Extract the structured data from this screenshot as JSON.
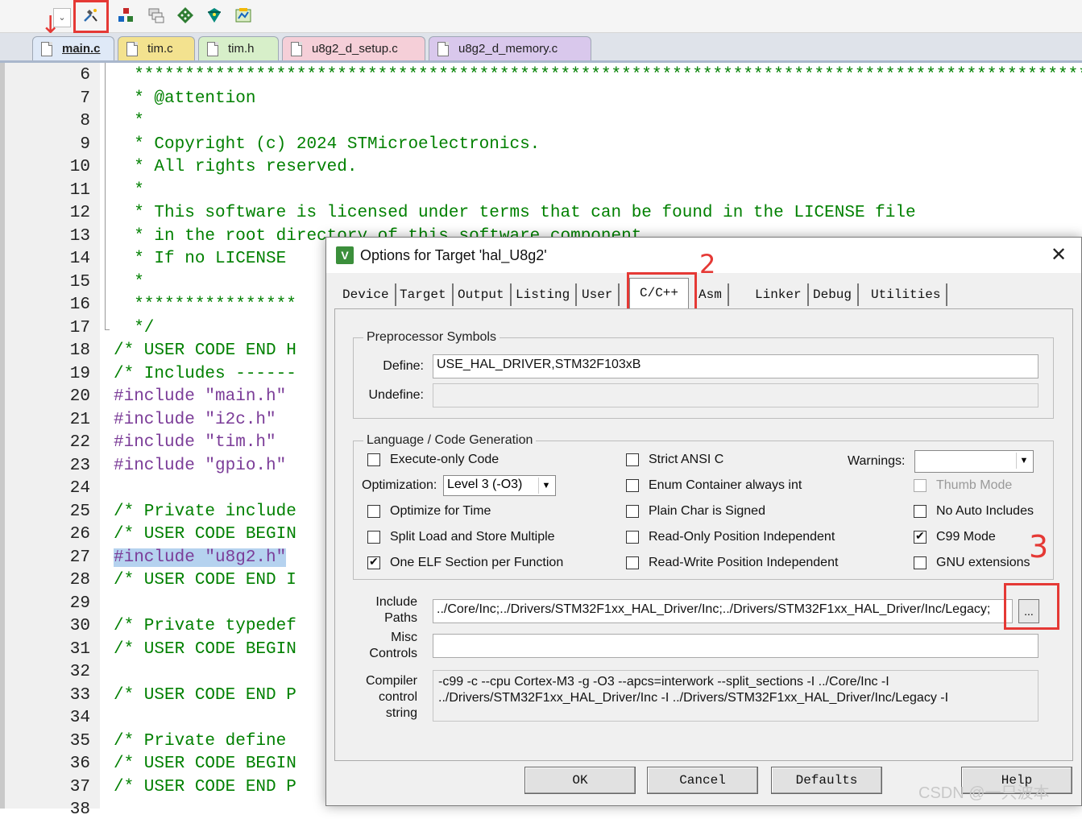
{
  "toolbar": {
    "dropdown_arrow": "⌄",
    "buttons": [
      {
        "name": "options-for-target-icon",
        "color": "#2b6cb0"
      },
      {
        "name": "manage-project-items-icon",
        "color": "#c62828"
      },
      {
        "name": "select-packs-icon",
        "color": "#777777"
      },
      {
        "name": "manage-run-time-environment-icon",
        "color": "#2e7d32"
      },
      {
        "name": "pack-installer-icon",
        "color": "#00897b"
      },
      {
        "name": "configure-icon",
        "color": "#558b2f"
      }
    ]
  },
  "tabs": [
    {
      "label": "main.c",
      "active": true,
      "color": "#dfe9f7"
    },
    {
      "label": "tim.c",
      "color": "#f3e28f"
    },
    {
      "label": "tim.h",
      "color": "#d7efc9"
    },
    {
      "label": "u8g2_d_setup.c",
      "color": "#f5cfd8"
    },
    {
      "label": "u8g2_d_memory.c",
      "color": "#d9c8ec"
    }
  ],
  "editor": {
    "lines": [
      {
        "n": "6",
        "text": "  **************************************************************************************************",
        "kind": "comment"
      },
      {
        "n": "7",
        "text": "  * @attention",
        "kind": "comment"
      },
      {
        "n": "8",
        "text": "  *",
        "kind": "comment"
      },
      {
        "n": "9",
        "text": "  * Copyright (c) 2024 STMicroelectronics.",
        "kind": "comment"
      },
      {
        "n": "10",
        "text": "  * All rights reserved.",
        "kind": "comment"
      },
      {
        "n": "11",
        "text": "  *",
        "kind": "comment"
      },
      {
        "n": "12",
        "text": "  * This software is licensed under terms that can be found in the LICENSE file",
        "kind": "comment"
      },
      {
        "n": "13",
        "text": "  * in the root directory of this software component.",
        "kind": "comment"
      },
      {
        "n": "14",
        "text": "  * If no LICENSE",
        "kind": "comment"
      },
      {
        "n": "15",
        "text": "  *",
        "kind": "comment"
      },
      {
        "n": "16",
        "text": "  ****************",
        "kind": "comment"
      },
      {
        "n": "17",
        "text": "  */",
        "kind": "comment"
      },
      {
        "n": "18",
        "text": "/* USER CODE END H",
        "kind": "comment"
      },
      {
        "n": "19",
        "text": "/* Includes ------",
        "kind": "comment"
      },
      {
        "n": "20",
        "pre": "#include ",
        "str": "\"main.h\"",
        "kind": "include"
      },
      {
        "n": "21",
        "pre": "#include ",
        "str": "\"i2c.h\"",
        "kind": "include"
      },
      {
        "n": "22",
        "pre": "#include ",
        "str": "\"tim.h\"",
        "kind": "include"
      },
      {
        "n": "23",
        "pre": "#include ",
        "str": "\"gpio.h\"",
        "kind": "include"
      },
      {
        "n": "24",
        "text": "",
        "kind": "comment"
      },
      {
        "n": "25",
        "text": "/* Private include",
        "kind": "comment"
      },
      {
        "n": "26",
        "text": "/* USER CODE BEGIN",
        "kind": "comment"
      },
      {
        "n": "27",
        "pre": "#include ",
        "str": "\"u8g2.h\"",
        "kind": "include",
        "selected": true
      },
      {
        "n": "28",
        "text": "/* USER CODE END I",
        "kind": "comment"
      },
      {
        "n": "29",
        "text": "",
        "kind": "comment"
      },
      {
        "n": "30",
        "text": "/* Private typedef",
        "kind": "comment"
      },
      {
        "n": "31",
        "text": "/* USER CODE BEGIN",
        "kind": "comment"
      },
      {
        "n": "32",
        "text": "",
        "kind": "comment"
      },
      {
        "n": "33",
        "text": "/* USER CODE END P",
        "kind": "comment"
      },
      {
        "n": "34",
        "text": "",
        "kind": "comment"
      },
      {
        "n": "35",
        "text": "/* Private define ",
        "kind": "comment"
      },
      {
        "n": "36",
        "text": "/* USER CODE BEGIN",
        "kind": "comment"
      },
      {
        "n": "37",
        "text": "/* USER CODE END P",
        "kind": "comment"
      },
      {
        "n": "38",
        "text": "",
        "kind": "comment"
      }
    ]
  },
  "dialog": {
    "icon_text": "V",
    "title": "Options for Target 'hal_U8g2'",
    "close": "✕",
    "tabs": [
      "Device",
      "Target",
      "Output",
      "Listing",
      "User",
      "C/C++",
      "Asm",
      "Linker",
      "Debug",
      "Utilities"
    ],
    "active_tab": "C/C++",
    "preprocessor": {
      "legend": "Preprocessor Symbols",
      "define_label": "Define:",
      "define_value": "USE_HAL_DRIVER,STM32F103xB",
      "undefine_label": "Undefine:",
      "undefine_value": ""
    },
    "language": {
      "legend": "Language / Code Generation",
      "execute_only": {
        "label": "Execute-only Code",
        "checked": false
      },
      "optimization_label": "Optimization:",
      "optimization_value": "Level 3 (-O3)",
      "optimize_time": {
        "label": "Optimize for Time",
        "checked": false
      },
      "split_load": {
        "label": "Split Load and Store Multiple",
        "checked": false
      },
      "one_elf": {
        "label": "One ELF Section per Function",
        "checked": true
      },
      "strict_ansi": {
        "label": "Strict ANSI C",
        "checked": false
      },
      "enum_container": {
        "label": "Enum Container always int",
        "checked": false
      },
      "plain_char": {
        "label": "Plain Char is Signed",
        "checked": false
      },
      "ropi": {
        "label": "Read-Only Position Independent",
        "checked": false
      },
      "rwpi": {
        "label": "Read-Write Position Independent",
        "checked": false
      },
      "warnings_label": "Warnings:",
      "warnings_value": "",
      "thumb_mode": {
        "label": "Thumb Mode",
        "checked": false,
        "disabled": true
      },
      "no_auto_includes": {
        "label": "No Auto Includes",
        "checked": false
      },
      "c99_mode": {
        "label": "C99 Mode",
        "checked": true
      },
      "gnu_ext": {
        "label": "GNU extensions",
        "checked": false
      }
    },
    "include_paths_label_1": "Include",
    "include_paths_label_2": "Paths",
    "include_paths_value": "../Core/Inc;../Drivers/STM32F1xx_HAL_Driver/Inc;../Drivers/STM32F1xx_HAL_Driver/Inc/Legacy;",
    "ellipsis": "...",
    "misc_label_1": "Misc",
    "misc_label_2": "Controls",
    "misc_value": "",
    "compiler_label_1": "Compiler",
    "compiler_label_2": "control",
    "compiler_label_3": "string",
    "compiler_line_1": "-c99 -c --cpu Cortex-M3 -g -O3 --apcs=interwork --split_sections -I ../Core/Inc -I",
    "compiler_line_2": "../Drivers/STM32F1xx_HAL_Driver/Inc -I ../Drivers/STM32F1xx_HAL_Driver/Inc/Legacy -I",
    "buttons": {
      "ok": "OK",
      "cancel": "Cancel",
      "defaults": "Defaults",
      "help": "Help"
    }
  },
  "annotations": {
    "step2": "2",
    "step3": "3",
    "highlight_color": "#e53935"
  },
  "watermark": "CSDN @一只波本"
}
